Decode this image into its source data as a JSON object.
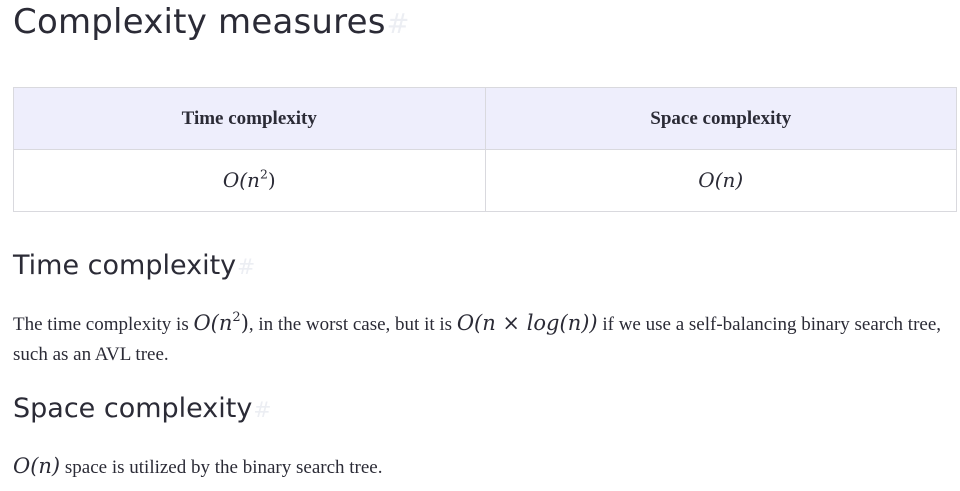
{
  "headings": {
    "main": "Complexity measures",
    "time": "Time complexity",
    "space": "Space complexity",
    "anchor_glyph": "#"
  },
  "table": {
    "headers": [
      "Time complexity",
      "Space complexity"
    ],
    "row": {
      "time_prefix": "O(n",
      "time_exp": "2",
      "time_suffix": ")",
      "space": "O(n)"
    }
  },
  "time_paragraph": {
    "text1": "The time complexity is ",
    "math1_prefix": "O(n",
    "math1_exp": "2",
    "math1_suffix": ")",
    "text2": ", in the worst case, but it is ",
    "math2": "O(n × log(n))",
    "text3": " if we use a self-balancing binary search tree, such as an AVL tree."
  },
  "space_paragraph": {
    "math": "O(n)",
    "text": " space is utilized by the binary search tree."
  },
  "colors": {
    "text": "#2b2b36",
    "table_header_bg": "#eeeefc",
    "table_border": "#d9d9de",
    "anchor": "#eceef3"
  }
}
